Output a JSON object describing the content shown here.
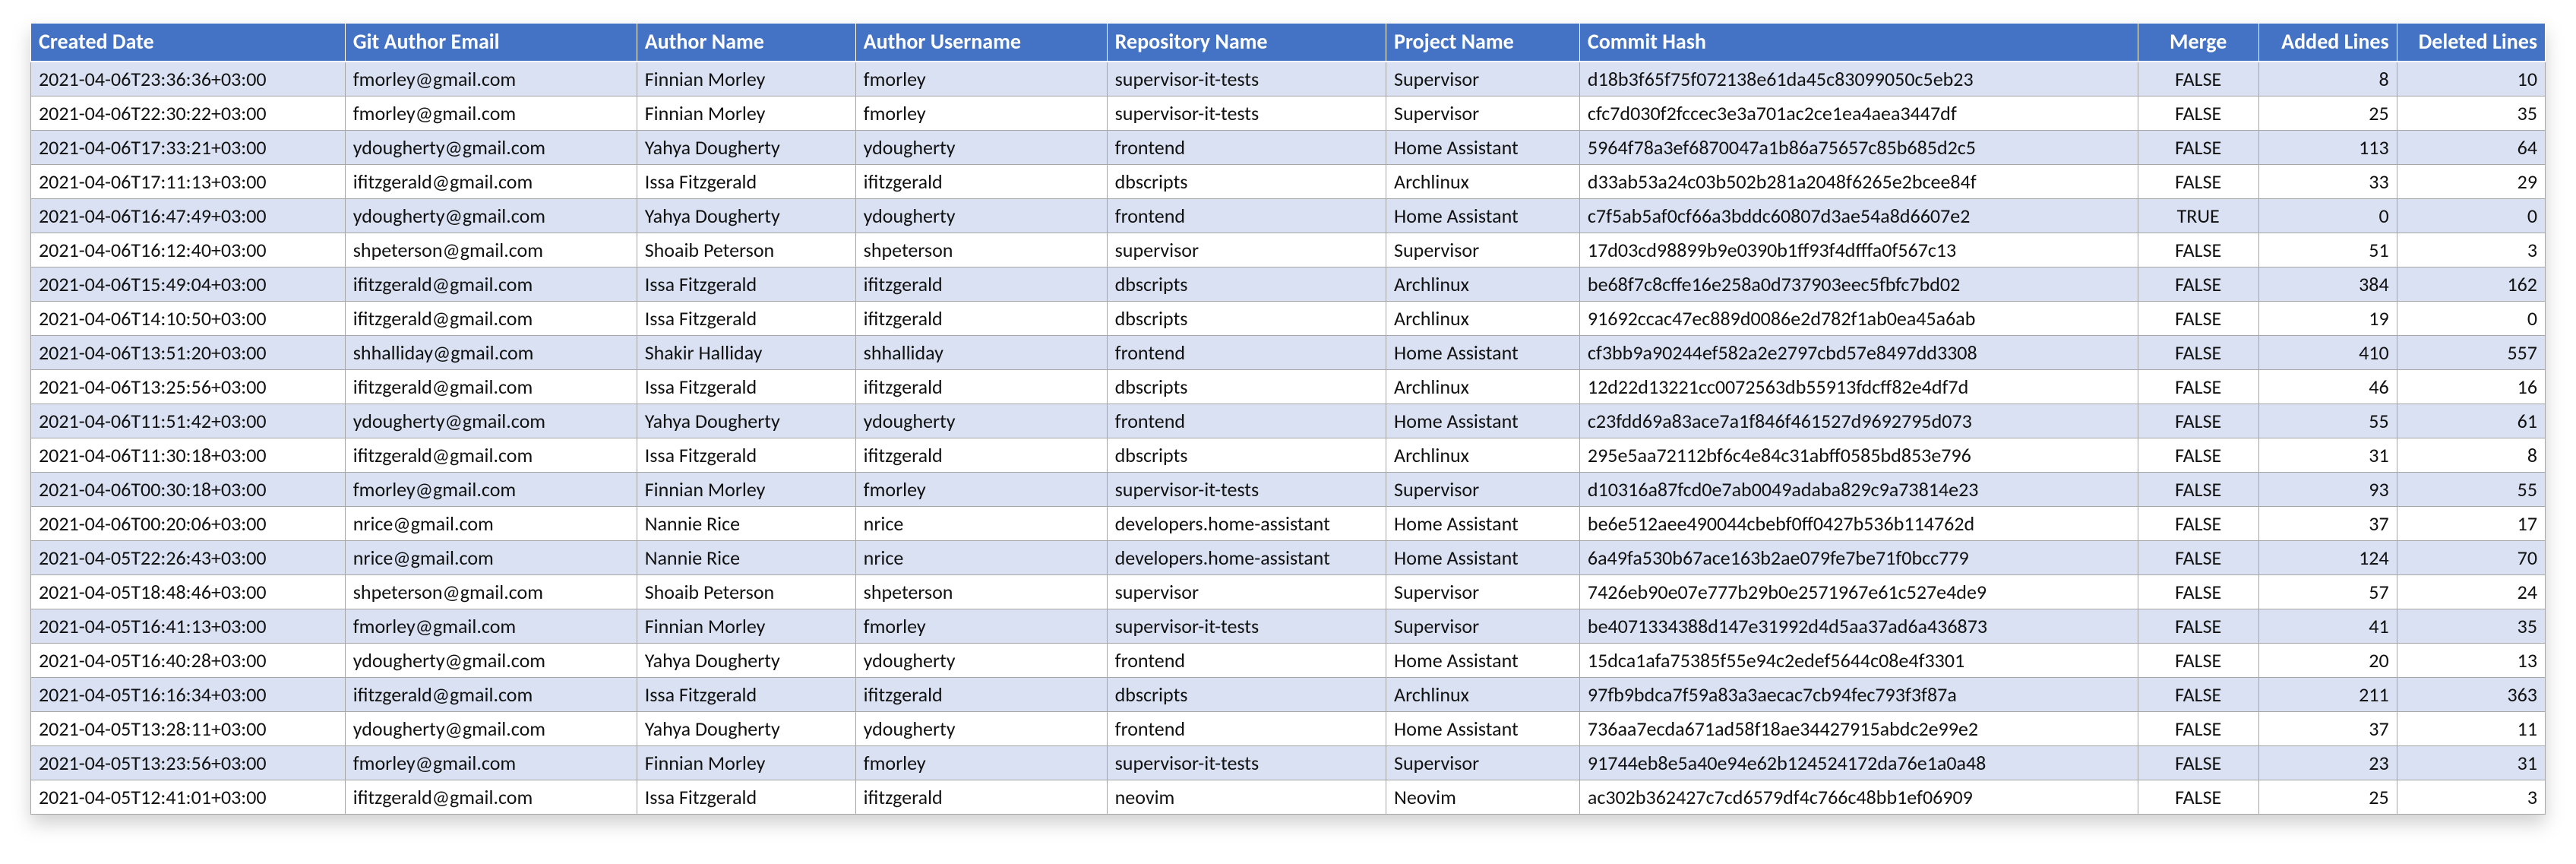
{
  "columns": [
    {
      "label": "Created Date",
      "align": "left"
    },
    {
      "label": "Git Author Email",
      "align": "left"
    },
    {
      "label": "Author Name",
      "align": "left"
    },
    {
      "label": "Author Username",
      "align": "left"
    },
    {
      "label": "Repository Name",
      "align": "left"
    },
    {
      "label": "Project Name",
      "align": "left"
    },
    {
      "label": "Commit Hash",
      "align": "left"
    },
    {
      "label": "Merge",
      "align": "center"
    },
    {
      "label": "Added Lines",
      "align": "right"
    },
    {
      "label": "Deleted Lines",
      "align": "right"
    }
  ],
  "rows": [
    [
      "2021-04-06T23:36:36+03:00",
      "fmorley@gmail.com",
      "Finnian Morley",
      "fmorley",
      "supervisor-it-tests",
      "Supervisor",
      "d18b3f65f75f072138e61da45c83099050c5eb23",
      "FALSE",
      "8",
      "10"
    ],
    [
      "2021-04-06T22:30:22+03:00",
      "fmorley@gmail.com",
      "Finnian Morley",
      "fmorley",
      "supervisor-it-tests",
      "Supervisor",
      "cfc7d030f2fccec3e3a701ac2ce1ea4aea3447df",
      "FALSE",
      "25",
      "35"
    ],
    [
      "2021-04-06T17:33:21+03:00",
      "ydougherty@gmail.com",
      "Yahya Dougherty",
      "ydougherty",
      "frontend",
      "Home Assistant",
      "5964f78a3ef6870047a1b86a75657c85b685d2c5",
      "FALSE",
      "113",
      "64"
    ],
    [
      "2021-04-06T17:11:13+03:00",
      "ifitzgerald@gmail.com",
      "Issa Fitzgerald",
      "ifitzgerald",
      "dbscripts",
      "Archlinux",
      "d33ab53a24c03b502b281a2048f6265e2bcee84f",
      "FALSE",
      "33",
      "29"
    ],
    [
      "2021-04-06T16:47:49+03:00",
      "ydougherty@gmail.com",
      "Yahya Dougherty",
      "ydougherty",
      "frontend",
      "Home Assistant",
      "c7f5ab5af0cf66a3bddc60807d3ae54a8d6607e2",
      "TRUE",
      "0",
      "0"
    ],
    [
      "2021-04-06T16:12:40+03:00",
      "shpeterson@gmail.com",
      "Shoaib Peterson",
      "shpeterson",
      "supervisor",
      "Supervisor",
      "17d03cd98899b9e0390b1ff93f4dfffa0f567c13",
      "FALSE",
      "51",
      "3"
    ],
    [
      "2021-04-06T15:49:04+03:00",
      "ifitzgerald@gmail.com",
      "Issa Fitzgerald",
      "ifitzgerald",
      "dbscripts",
      "Archlinux",
      "be68f7c8cffe16e258a0d737903eec5fbfc7bd02",
      "FALSE",
      "384",
      "162"
    ],
    [
      "2021-04-06T14:10:50+03:00",
      "ifitzgerald@gmail.com",
      "Issa Fitzgerald",
      "ifitzgerald",
      "dbscripts",
      "Archlinux",
      "91692ccac47ec889d0086e2d782f1ab0ea45a6ab",
      "FALSE",
      "19",
      "0"
    ],
    [
      "2021-04-06T13:51:20+03:00",
      "shhalliday@gmail.com",
      "Shakir Halliday",
      "shhalliday",
      "frontend",
      "Home Assistant",
      "cf3bb9a90244ef582a2e2797cbd57e8497dd3308",
      "FALSE",
      "410",
      "557"
    ],
    [
      "2021-04-06T13:25:56+03:00",
      "ifitzgerald@gmail.com",
      "Issa Fitzgerald",
      "ifitzgerald",
      "dbscripts",
      "Archlinux",
      "12d22d13221cc0072563db55913fdcff82e4df7d",
      "FALSE",
      "46",
      "16"
    ],
    [
      "2021-04-06T11:51:42+03:00",
      "ydougherty@gmail.com",
      "Yahya Dougherty",
      "ydougherty",
      "frontend",
      "Home Assistant",
      "c23fdd69a83ace7a1f846f461527d9692795d073",
      "FALSE",
      "55",
      "61"
    ],
    [
      "2021-04-06T11:30:18+03:00",
      "ifitzgerald@gmail.com",
      "Issa Fitzgerald",
      "ifitzgerald",
      "dbscripts",
      "Archlinux",
      "295e5aa72112bf6c4e84c31abff0585bd853e796",
      "FALSE",
      "31",
      "8"
    ],
    [
      "2021-04-06T00:30:18+03:00",
      "fmorley@gmail.com",
      "Finnian Morley",
      "fmorley",
      "supervisor-it-tests",
      "Supervisor",
      "d10316a87fcd0e7ab0049adaba829c9a73814e23",
      "FALSE",
      "93",
      "55"
    ],
    [
      "2021-04-06T00:20:06+03:00",
      "nrice@gmail.com",
      "Nannie Rice",
      "nrice",
      "developers.home-assistant",
      "Home Assistant",
      "be6e512aee490044cbebf0ff0427b536b114762d",
      "FALSE",
      "37",
      "17"
    ],
    [
      "2021-04-05T22:26:43+03:00",
      "nrice@gmail.com",
      "Nannie Rice",
      "nrice",
      "developers.home-assistant",
      "Home Assistant",
      "6a49fa530b67ace163b2ae079fe7be71f0bcc779",
      "FALSE",
      "124",
      "70"
    ],
    [
      "2021-04-05T18:48:46+03:00",
      "shpeterson@gmail.com",
      "Shoaib Peterson",
      "shpeterson",
      "supervisor",
      "Supervisor",
      "7426eb90e07e777b29b0e2571967e61c527e4de9",
      "FALSE",
      "57",
      "24"
    ],
    [
      "2021-04-05T16:41:13+03:00",
      "fmorley@gmail.com",
      "Finnian Morley",
      "fmorley",
      "supervisor-it-tests",
      "Supervisor",
      "be4071334388d147e31992d4d5aa37ad6a436873",
      "FALSE",
      "41",
      "35"
    ],
    [
      "2021-04-05T16:40:28+03:00",
      "ydougherty@gmail.com",
      "Yahya Dougherty",
      "ydougherty",
      "frontend",
      "Home Assistant",
      "15dca1afa75385f55e94c2edef5644c08e4f3301",
      "FALSE",
      "20",
      "13"
    ],
    [
      "2021-04-05T16:16:34+03:00",
      "ifitzgerald@gmail.com",
      "Issa Fitzgerald",
      "ifitzgerald",
      "dbscripts",
      "Archlinux",
      "97fb9bdca7f59a83a3aecac7cb94fec793f3f87a",
      "FALSE",
      "211",
      "363"
    ],
    [
      "2021-04-05T13:28:11+03:00",
      "ydougherty@gmail.com",
      "Yahya Dougherty",
      "ydougherty",
      "frontend",
      "Home Assistant",
      "736aa7ecda671ad58f18ae34427915abdc2e99e2",
      "FALSE",
      "37",
      "11"
    ],
    [
      "2021-04-05T13:23:56+03:00",
      "fmorley@gmail.com",
      "Finnian Morley",
      "fmorley",
      "supervisor-it-tests",
      "Supervisor",
      "91744eb8e5a40e94e62b124524172da76e1a0a48",
      "FALSE",
      "23",
      "31"
    ],
    [
      "2021-04-05T12:41:01+03:00",
      "ifitzgerald@gmail.com",
      "Issa Fitzgerald",
      "ifitzgerald",
      "neovim",
      "Neovim",
      "ac302b362427c7cd6579df4c766c48bb1ef06909",
      "FALSE",
      "25",
      "3"
    ]
  ]
}
